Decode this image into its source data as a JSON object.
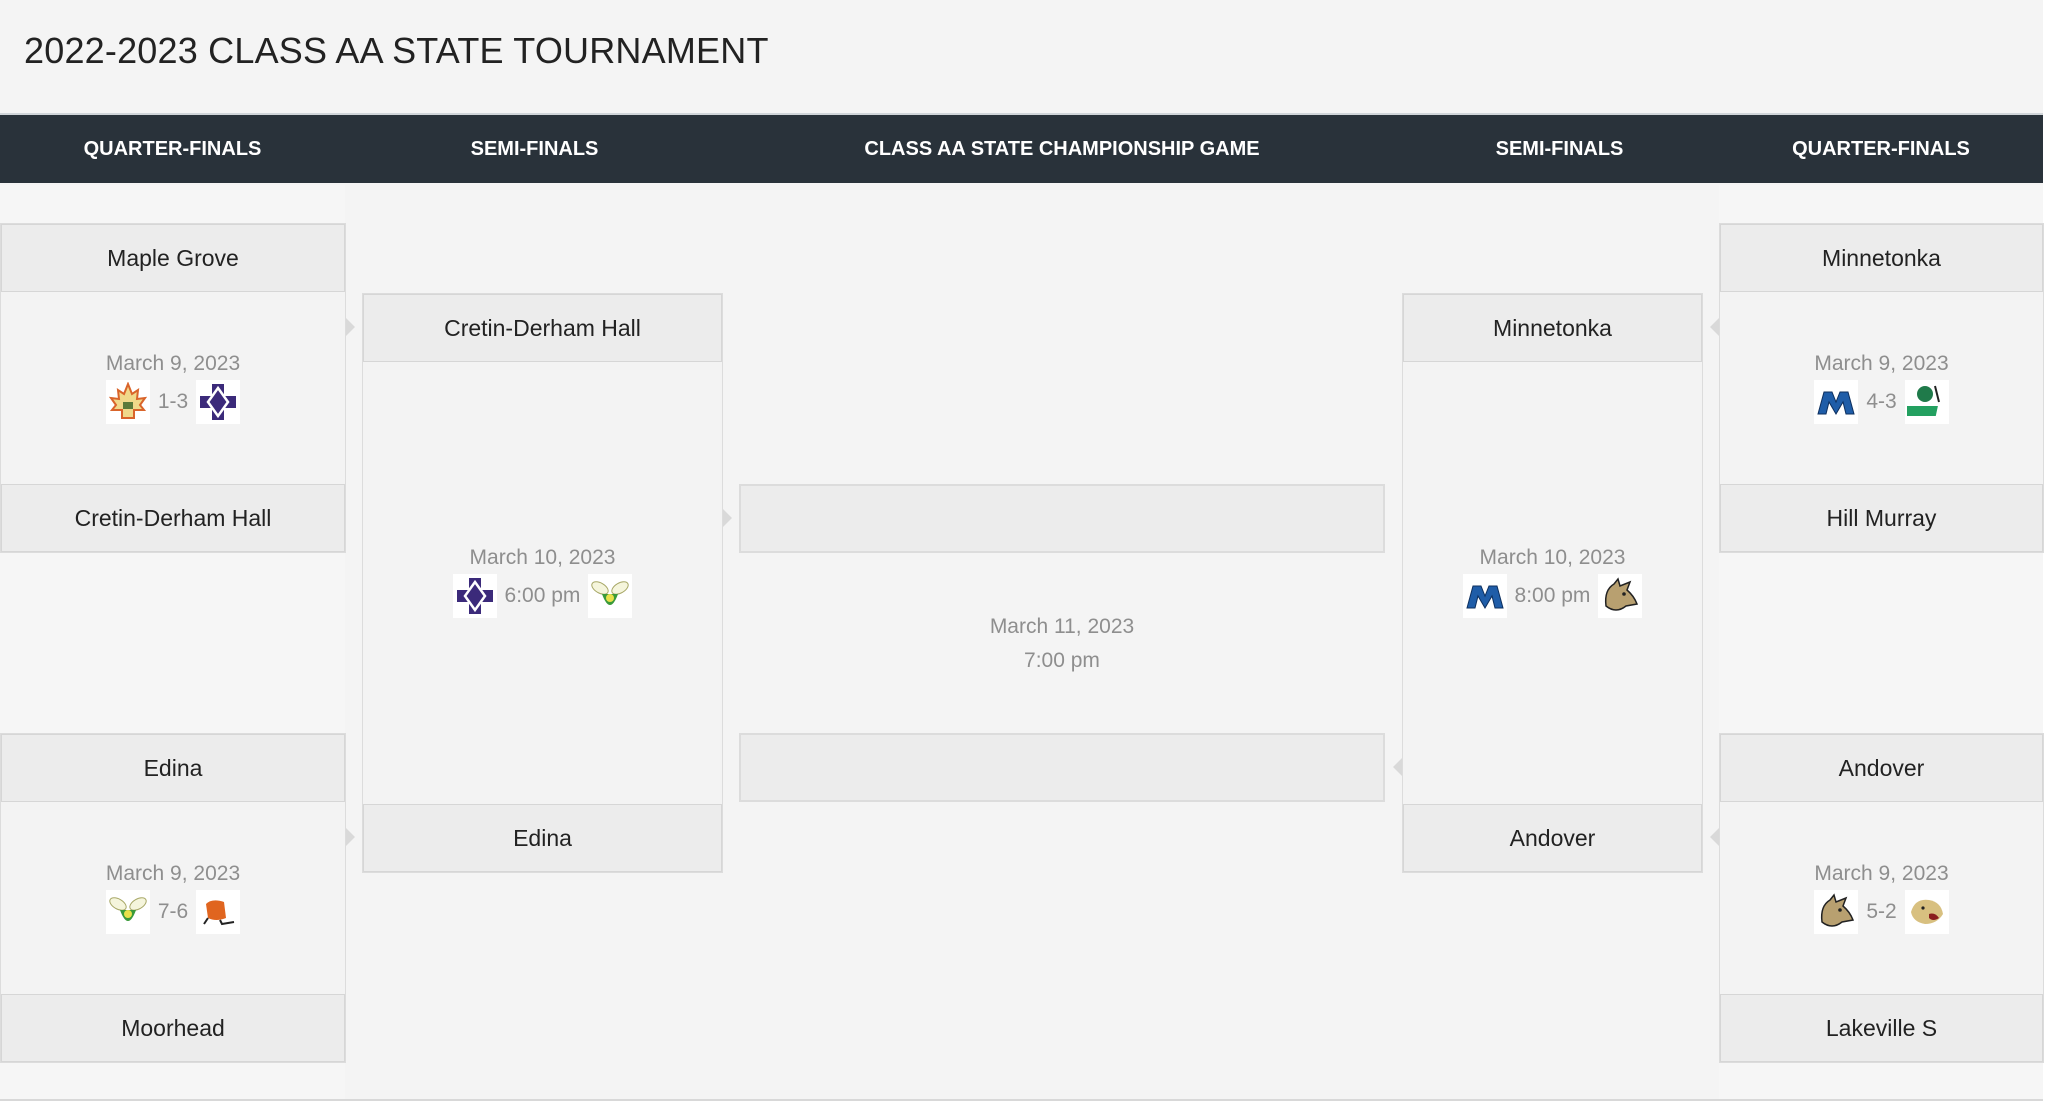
{
  "title": "2022-2023 CLASS AA STATE TOURNAMENT",
  "columns": [
    "QUARTER-FINALS",
    "SEMI-FINALS",
    "CLASS AA STATE CHAMPIONSHIP GAME",
    "SEMI-FINALS",
    "QUARTER-FINALS"
  ],
  "quarterfinals_left": [
    {
      "top_team": "Maple Grove",
      "bottom_team": "Cretin-Derham Hall",
      "date": "March 9, 2023",
      "result": "1-3",
      "top_logo": "maple-leaf-logo",
      "bottom_logo": "cdh-cross-logo"
    },
    {
      "top_team": "Edina",
      "bottom_team": "Moorhead",
      "date": "March 9, 2023",
      "result": "7-6",
      "top_logo": "hornet-logo",
      "bottom_logo": "spud-logo"
    }
  ],
  "semifinal_left": {
    "top_team": "Cretin-Derham Hall",
    "bottom_team": "Edina",
    "date": "March 10, 2023",
    "time": "6:00 pm",
    "top_logo": "cdh-cross-logo",
    "bottom_logo": "hornet-logo"
  },
  "final": {
    "top_team": "",
    "bottom_team": "",
    "date": "March 11, 2023",
    "time": "7:00 pm"
  },
  "semifinal_right": {
    "top_team": "Minnetonka",
    "bottom_team": "Andover",
    "date": "March 10, 2023",
    "time": "8:00 pm",
    "top_logo": "minnetonka-m-logo",
    "bottom_logo": "husky-logo"
  },
  "quarterfinals_right": [
    {
      "top_team": "Minnetonka",
      "bottom_team": "Hill Murray",
      "date": "March 9, 2023",
      "result": "4-3",
      "top_logo": "minnetonka-m-logo",
      "bottom_logo": "pioneers-logo"
    },
    {
      "top_team": "Andover",
      "bottom_team": "Lakeville S",
      "date": "March 9, 2023",
      "result": "5-2",
      "top_logo": "husky-logo",
      "bottom_logo": "cougar-logo"
    }
  ],
  "colors": {
    "header_bg": "#29323a",
    "page_bg": "#f4f4f4",
    "row_bg": "#ececec",
    "muted_text": "#8e8e8e"
  }
}
